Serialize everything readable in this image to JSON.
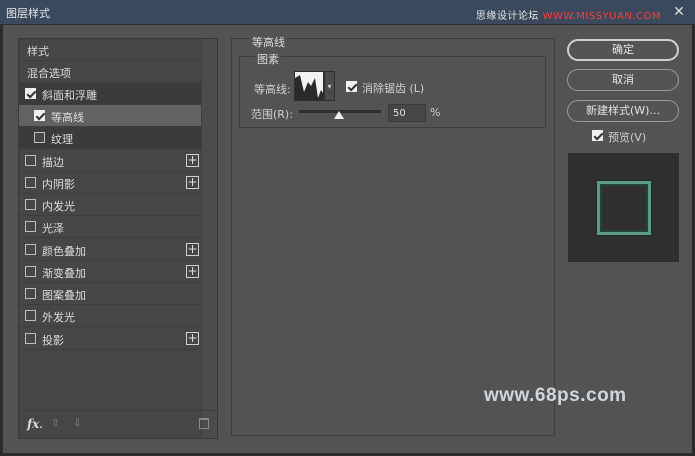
{
  "window": {
    "title": "图层样式",
    "close_glyph": "✕"
  },
  "watermark_top": {
    "part1": "思缘设计论坛 ",
    "part2": "WWW.MISSYUAN.COM"
  },
  "stylelist": {
    "header": "样式",
    "blend_options": "混合选项",
    "items": [
      {
        "label": "斜面和浮雕",
        "checked": true
      },
      {
        "label": "等高线",
        "checked": true
      },
      {
        "label": "纹理",
        "checked": false
      },
      {
        "label": "描边",
        "checked": false,
        "plus": "+"
      },
      {
        "label": "内阴影",
        "checked": false,
        "plus": "+"
      },
      {
        "label": "内发光",
        "checked": false
      },
      {
        "label": "光泽",
        "checked": false
      },
      {
        "label": "颜色叠加",
        "checked": false,
        "plus": "+"
      },
      {
        "label": "渐变叠加",
        "checked": false,
        "plus": "+"
      },
      {
        "label": "图案叠加",
        "checked": false
      },
      {
        "label": "外发光",
        "checked": false
      },
      {
        "label": "投影",
        "checked": false,
        "plus": "+"
      }
    ],
    "fx_label": "fx",
    "fx_dot": ".",
    "up_glyph": "⇧",
    "down_glyph": "⇩"
  },
  "contour_panel": {
    "group_title": "等高线",
    "subgroup_title": "图素",
    "contour_label": "等高线:",
    "contour_drop_glyph": "▾",
    "antialias_label": "消除锯齿 (L)",
    "antialias_checked": true,
    "range_label": "范围(R):",
    "range_value": "50",
    "range_unit": "%"
  },
  "buttons": {
    "ok": "确定",
    "cancel": "取消",
    "new_style": "新建样式(W)...",
    "preview_label": "预览(V)",
    "preview_checked": true
  },
  "watermark_bottom": "www.68ps.com",
  "colors": {
    "titlebar": "#3a4a5c",
    "panel": "#535353",
    "preview_accent": "#5e9a85"
  }
}
